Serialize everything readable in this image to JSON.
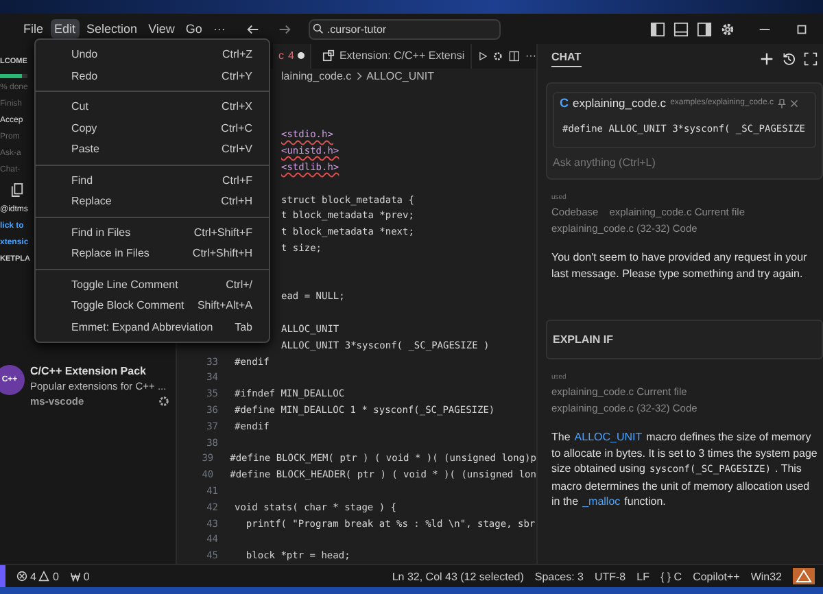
{
  "menubar": [
    {
      "label": "File",
      "selected": false
    },
    {
      "label": "Edit",
      "selected": true
    },
    {
      "label": "Selection",
      "selected": false
    },
    {
      "label": "View",
      "selected": false
    },
    {
      "label": "Go",
      "selected": false
    },
    {
      "label": "···",
      "selected": false
    }
  ],
  "search": {
    "value": ".cursor-tutor"
  },
  "sidebar": {
    "fragments": [
      {
        "kind": "heading",
        "text": "LCOME"
      },
      {
        "kind": "progress",
        "level": 0.8,
        "text": "% done"
      },
      {
        "kind": "dim",
        "text": "Finish"
      },
      {
        "kind": "bright",
        "text": "Accep"
      },
      {
        "kind": "dim",
        "text": "Prom"
      },
      {
        "kind": "dim",
        "text": "Ask-a"
      },
      {
        "kind": "dim",
        "text": "Chat-"
      },
      {
        "kind": "copy"
      },
      {
        "kind": "bright",
        "text": "@idtms"
      },
      {
        "kind": "link",
        "text": "lick to"
      },
      {
        "kind": "link",
        "text": "xtensic"
      },
      {
        "kind": "heading",
        "text": "KETPLA"
      }
    ],
    "extension": {
      "icon": "C++",
      "title": "C/C++ Extension Pack",
      "description": "Popular extensions for C++ ...",
      "publisher": "ms-vscode"
    }
  },
  "edit_menu": [
    {
      "kind": "item",
      "label": "Undo",
      "shortcut": "Ctrl+Z"
    },
    {
      "kind": "item",
      "label": "Redo",
      "shortcut": "Ctrl+Y"
    },
    {
      "kind": "separator"
    },
    {
      "kind": "item",
      "label": "Cut",
      "shortcut": "Ctrl+X"
    },
    {
      "kind": "item",
      "label": "Copy",
      "shortcut": "Ctrl+C"
    },
    {
      "kind": "item",
      "label": "Paste",
      "shortcut": "Ctrl+V"
    },
    {
      "kind": "separator"
    },
    {
      "kind": "item",
      "label": "Find",
      "shortcut": "Ctrl+F"
    },
    {
      "kind": "item",
      "label": "Replace",
      "shortcut": "Ctrl+H"
    },
    {
      "kind": "separator"
    },
    {
      "kind": "item",
      "label": "Find in Files",
      "shortcut": "Ctrl+Shift+F"
    },
    {
      "kind": "item",
      "label": "Replace in Files",
      "shortcut": "Ctrl+Shift+H"
    },
    {
      "kind": "separator"
    },
    {
      "kind": "item",
      "label": "Toggle Line Comment",
      "shortcut": "Ctrl+/"
    },
    {
      "kind": "item",
      "label": "Toggle Block Comment",
      "shortcut": "Shift+Alt+A"
    },
    {
      "kind": "item",
      "label": "Emmet: Expand Abbreviation",
      "shortcut": "Tab"
    }
  ],
  "editor": {
    "tabs": [
      {
        "label": "c",
        "badge": "4",
        "modified": true,
        "selected": true
      },
      {
        "label": "Extension: C/C++ Extensi",
        "selected": false
      }
    ],
    "more": "···",
    "breadcrumb": [
      "laining_code.c",
      "ALLOC_UNIT"
    ],
    "lines": [
      {
        "kind": "blank"
      },
      {
        "kind": "blank"
      },
      {
        "kind": "partial",
        "text": "<stdio.h>",
        "error": true
      },
      {
        "kind": "partial",
        "text": "<unistd.h>",
        "error": true
      },
      {
        "kind": "partial",
        "text": "<stdlib.h>",
        "error": true
      },
      {
        "kind": "blank"
      },
      {
        "kind": "partial",
        "text": "struct block_metadata {"
      },
      {
        "kind": "partial",
        "text": "t block_metadata *prev;"
      },
      {
        "kind": "partial",
        "text": "t block_metadata *next;"
      },
      {
        "kind": "partial",
        "text": "t size;"
      },
      {
        "kind": "blank"
      },
      {
        "kind": "blank"
      },
      {
        "kind": "partial",
        "text": "ead = NULL;"
      },
      {
        "kind": "blank"
      },
      {
        "kind": "partial",
        "text": "ALLOC_UNIT"
      },
      {
        "kind": "partial",
        "text": "ALLOC_UNIT 3*sysconf( _SC_PAGESIZE )"
      },
      {
        "kind": "full",
        "number": "33",
        "text": "#endif"
      },
      {
        "kind": "full",
        "number": "34"
      },
      {
        "kind": "full",
        "number": "35",
        "text": "#ifndef MIN_DEALLOC"
      },
      {
        "kind": "full",
        "number": "36",
        "text": "#define MIN_DEALLOC 1 * sysconf(_SC_PAGESIZE)"
      },
      {
        "kind": "full",
        "number": "37",
        "text": "#endif"
      },
      {
        "kind": "full",
        "number": "38"
      },
      {
        "kind": "full",
        "number": "39",
        "text": "#define BLOCK_MEM( ptr ) ( void * )( (unsigned long)p"
      },
      {
        "kind": "full",
        "number": "40",
        "text": "#define BLOCK_HEADER( ptr ) ( void * )( (unsigned lon"
      },
      {
        "kind": "full",
        "number": "41"
      },
      {
        "kind": "full",
        "number": "42",
        "text": "void stats( char * stage ) {"
      },
      {
        "kind": "full",
        "number": "43",
        "text": "  printf( \"Program break at %s : %ld \\n\", stage, sbr"
      },
      {
        "kind": "full",
        "number": "44"
      },
      {
        "kind": "full",
        "number": "45",
        "text": "  block *ptr = head;"
      }
    ]
  },
  "chat": {
    "tab": "CHAT",
    "input_card": {
      "language": "C",
      "file": "explaining_code.c",
      "path": "examples/explaining_code.c",
      "code": "#define ALLOC_UNIT 3*sysconf( _SC_PAGESIZE",
      "placeholder": "Ask anything (Ctrl+L)"
    },
    "messages": [
      {
        "kind": "reply",
        "used_label": "used",
        "context": [
          [
            "Codebase",
            "explaining_code.c Current file"
          ],
          [
            "explaining_code.c (32-32) Code"
          ]
        ],
        "segments": [
          {
            "kind": "plain",
            "text": "You don't seem to have provided any request in your last message. Please type something and try again."
          }
        ]
      },
      {
        "kind": "prompt",
        "text": "EXPLAIN IF"
      },
      {
        "kind": "reply",
        "used_label": "used",
        "context": [
          [
            "explaining_code.c Current file"
          ],
          [
            "explaining_code.c (32-32) Code"
          ]
        ],
        "segments": [
          {
            "kind": "plain",
            "text": "The"
          },
          {
            "kind": "link",
            "text": "ALLOC_UNIT"
          },
          {
            "kind": "plain",
            "text": "macro defines the size of memory to allocate in bytes. It is set to 3 times the system page size obtained using"
          },
          {
            "kind": "code",
            "text": "sysconf(_SC_PAGESIZE)"
          },
          {
            "kind": "plain",
            "text": ". This macro determines the unit of memory allocation used in the"
          },
          {
            "kind": "link",
            "text": "_malloc"
          },
          {
            "kind": "plain",
            "text": "function."
          }
        ]
      }
    ]
  },
  "status_bar": {
    "errors": "4",
    "warnings": "0",
    "ports": "0",
    "right": [
      "Ln 32, Col 43 (12 selected)",
      "Spaces: 3",
      "UTF-8",
      "LF",
      "{ } C",
      "Copilot++",
      "Win32"
    ]
  }
}
